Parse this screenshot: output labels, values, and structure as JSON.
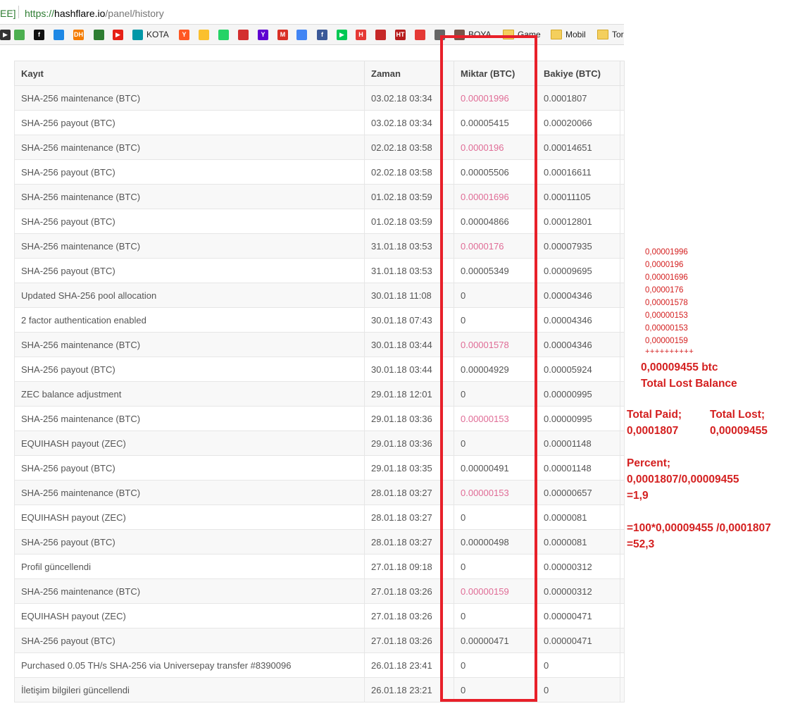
{
  "browser": {
    "tab_fragment": "EE]",
    "url_scheme": "https://",
    "url_host": "hashflare.io",
    "url_path": "/panel/history"
  },
  "bookmarks": [
    {
      "icon": "play-icon",
      "label": ""
    },
    {
      "icon": "maps-icon",
      "label": ""
    },
    {
      "icon": "f-icon",
      "label": ""
    },
    {
      "icon": "bird-icon",
      "label": ""
    },
    {
      "icon": "dh-icon",
      "label": ""
    },
    {
      "icon": "clover-icon",
      "label": ""
    },
    {
      "icon": "youtube-icon",
      "label": ""
    },
    {
      "icon": "kota-icon",
      "label": "KOTA"
    },
    {
      "icon": "y-icon",
      "label": ""
    },
    {
      "icon": "drive-icon",
      "label": ""
    },
    {
      "icon": "whatsapp-icon",
      "label": ""
    },
    {
      "icon": "red-circle-icon",
      "label": ""
    },
    {
      "icon": "yahoo-icon",
      "label": ""
    },
    {
      "icon": "gmail-icon",
      "label": ""
    },
    {
      "icon": "translate-icon",
      "label": ""
    },
    {
      "icon": "facebook-icon",
      "label": ""
    },
    {
      "icon": "play-store-icon",
      "label": ""
    },
    {
      "icon": "h-icon",
      "label": ""
    },
    {
      "icon": "book-icon",
      "label": ""
    },
    {
      "icon": "ht-icon",
      "label": ""
    },
    {
      "icon": "flame-icon",
      "label": ""
    },
    {
      "icon": "img-icon",
      "label": ""
    },
    {
      "icon": "boya-icon",
      "label": "BOYA"
    },
    {
      "icon": "folder-icon",
      "label": "Game"
    },
    {
      "icon": "folder-icon",
      "label": "Mobil"
    },
    {
      "icon": "folder-icon",
      "label": "Tor"
    }
  ],
  "table": {
    "headers": [
      "Kayıt",
      "Zaman",
      "Miktar (BTC)",
      "Bakiye (BTC)",
      ""
    ],
    "rows": [
      {
        "kayit": "SHA-256 maintenance (BTC)",
        "zaman": "03.02.18 03:34",
        "miktar": "0.00001996",
        "bakiye": "0.0001807",
        "neg": true
      },
      {
        "kayit": "SHA-256 payout (BTC)",
        "zaman": "03.02.18 03:34",
        "miktar": "0.00005415",
        "bakiye": "0.00020066",
        "neg": false
      },
      {
        "kayit": "SHA-256 maintenance (BTC)",
        "zaman": "02.02.18 03:58",
        "miktar": "0.0000196",
        "bakiye": "0.00014651",
        "neg": true
      },
      {
        "kayit": "SHA-256 payout (BTC)",
        "zaman": "02.02.18 03:58",
        "miktar": "0.00005506",
        "bakiye": "0.00016611",
        "neg": false
      },
      {
        "kayit": "SHA-256 maintenance (BTC)",
        "zaman": "01.02.18 03:59",
        "miktar": "0.00001696",
        "bakiye": "0.00011105",
        "neg": true
      },
      {
        "kayit": "SHA-256 payout (BTC)",
        "zaman": "01.02.18 03:59",
        "miktar": "0.00004866",
        "bakiye": "0.00012801",
        "neg": false
      },
      {
        "kayit": "SHA-256 maintenance (BTC)",
        "zaman": "31.01.18 03:53",
        "miktar": "0.0000176",
        "bakiye": "0.00007935",
        "neg": true
      },
      {
        "kayit": "SHA-256 payout (BTC)",
        "zaman": "31.01.18 03:53",
        "miktar": "0.00005349",
        "bakiye": "0.00009695",
        "neg": false
      },
      {
        "kayit": "Updated SHA-256 pool allocation",
        "zaman": "30.01.18 11:08",
        "miktar": "0",
        "bakiye": "0.00004346",
        "neg": false
      },
      {
        "kayit": "2 factor authentication enabled",
        "zaman": "30.01.18 07:43",
        "miktar": "0",
        "bakiye": "0.00004346",
        "neg": false
      },
      {
        "kayit": "SHA-256 maintenance (BTC)",
        "zaman": "30.01.18 03:44",
        "miktar": "0.00001578",
        "bakiye": "0.00004346",
        "neg": true
      },
      {
        "kayit": "SHA-256 payout (BTC)",
        "zaman": "30.01.18 03:44",
        "miktar": "0.00004929",
        "bakiye": "0.00005924",
        "neg": false
      },
      {
        "kayit": "ZEC balance adjustment",
        "zaman": "29.01.18 12:01",
        "miktar": "0",
        "bakiye": "0.00000995",
        "neg": false
      },
      {
        "kayit": "SHA-256 maintenance (BTC)",
        "zaman": "29.01.18 03:36",
        "miktar": "0.00000153",
        "bakiye": "0.00000995",
        "neg": true
      },
      {
        "kayit": "EQUIHASH payout (ZEC)",
        "zaman": "29.01.18 03:36",
        "miktar": "0",
        "bakiye": "0.00001148",
        "neg": false
      },
      {
        "kayit": "SHA-256 payout (BTC)",
        "zaman": "29.01.18 03:35",
        "miktar": "0.00000491",
        "bakiye": "0.00001148",
        "neg": false
      },
      {
        "kayit": "SHA-256 maintenance (BTC)",
        "zaman": "28.01.18 03:27",
        "miktar": "0.00000153",
        "bakiye": "0.00000657",
        "neg": true
      },
      {
        "kayit": "EQUIHASH payout (ZEC)",
        "zaman": "28.01.18 03:27",
        "miktar": "0",
        "bakiye": "0.0000081",
        "neg": false
      },
      {
        "kayit": "SHA-256 payout (BTC)",
        "zaman": "28.01.18 03:27",
        "miktar": "0.00000498",
        "bakiye": "0.0000081",
        "neg": false
      },
      {
        "kayit": "Profil güncellendi",
        "zaman": "27.01.18 09:18",
        "miktar": "0",
        "bakiye": "0.00000312",
        "neg": false
      },
      {
        "kayit": "SHA-256 maintenance (BTC)",
        "zaman": "27.01.18 03:26",
        "miktar": "0.00000159",
        "bakiye": "0.00000312",
        "neg": true
      },
      {
        "kayit": "EQUIHASH payout (ZEC)",
        "zaman": "27.01.18 03:26",
        "miktar": "0",
        "bakiye": "0.00000471",
        "neg": false
      },
      {
        "kayit": "SHA-256 payout (BTC)",
        "zaman": "27.01.18 03:26",
        "miktar": "0.00000471",
        "bakiye": "0.00000471",
        "neg": false
      },
      {
        "kayit": "Purchased 0.05 TH/s SHA-256 via Universepay transfer #8390096",
        "zaman": "26.01.18 23:41",
        "miktar": "0",
        "bakiye": "0",
        "neg": false
      },
      {
        "kayit": "İletişim bilgileri güncellendi",
        "zaman": "26.01.18 23:21",
        "miktar": "0",
        "bakiye": "0",
        "neg": false
      }
    ]
  },
  "annotations": {
    "lost_values": [
      "0,00001996",
      "0,0000196",
      "0,00001696",
      "0,0000176",
      "0,00001578",
      "0,00000153",
      "0,00000153",
      "0,00000159"
    ],
    "plus_line": "++++++++++",
    "total_value": "0,00009455 btc",
    "total_label": "Total Lost Balance",
    "paid_label": "Total Paid;",
    "lost_label": "Total Lost;",
    "paid_value": "0,0001807",
    "lost_value": "0,00009455",
    "percent_label": "Percent;",
    "ratio_expr": "0,0001807/0,00009455",
    "ratio_result": "=1,9",
    "pct_expr": "=100*0,00009455 /0,0001807",
    "pct_result": "=52,3",
    "color": "#d42020"
  }
}
